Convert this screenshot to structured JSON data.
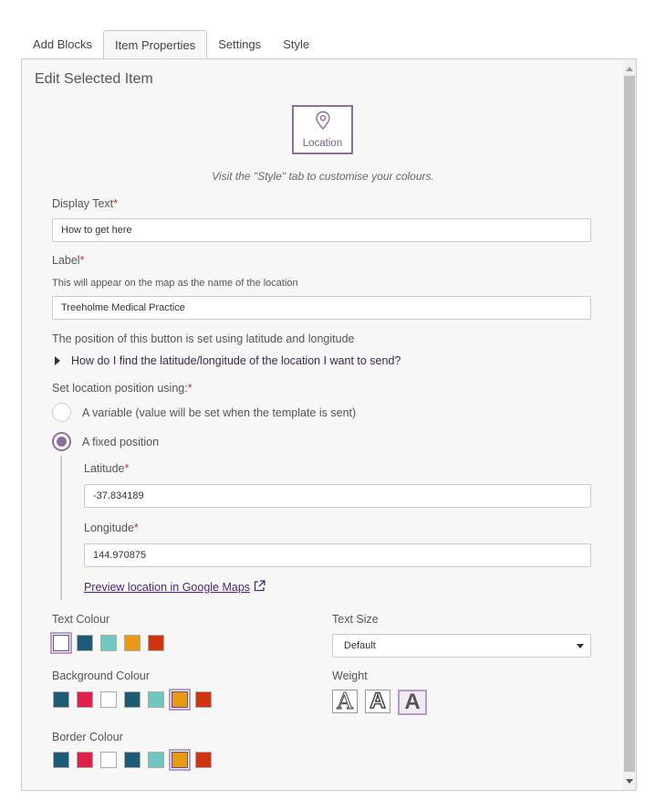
{
  "tabs": [
    {
      "label": "Add Blocks"
    },
    {
      "label": "Item Properties",
      "active": true
    },
    {
      "label": "Settings"
    },
    {
      "label": "Style"
    }
  ],
  "panel": {
    "heading": "Edit Selected Item",
    "tile": {
      "icon": "map-pin-icon",
      "label": "Location"
    },
    "hint": "Visit the \"Style\" tab to customise your colours.",
    "display_text": {
      "label": "Display Text",
      "required_mark": "*",
      "value": "How to get here"
    },
    "label_field": {
      "label": "Label",
      "required_mark": "*",
      "help": "This will appear on the map as the name of the location",
      "value": "Treeholme Medical Practice"
    },
    "position_note": "The position of this button is set using latitude and longitude",
    "disclosure": "How do I find the latitude/longitude of the location I want to send?",
    "set_position": {
      "label": "Set location position using:",
      "required_mark": "*",
      "options": [
        {
          "label": "A variable (value will be set when the template is sent)",
          "checked": false
        },
        {
          "label": "A fixed position",
          "checked": true
        }
      ]
    },
    "latitude": {
      "label": "Latitude",
      "required_mark": "*",
      "value": "-37.834189"
    },
    "longitude": {
      "label": "Longitude",
      "required_mark": "*",
      "value": "144.970875"
    },
    "preview_link": "Preview location in Google Maps",
    "text_colour": {
      "label": "Text Colour",
      "swatches": [
        "#ffffff",
        "#1d5a73",
        "#6fc8c0",
        "#e89a16",
        "#d0340f"
      ],
      "selected_index": 0
    },
    "background_colour": {
      "label": "Background Colour",
      "swatches": [
        "#1d5a73",
        "#e01f4c",
        "#ffffff",
        "#1d5a73",
        "#6fc8c0",
        "#e89a16",
        "#d0340f"
      ],
      "selected_index": 5
    },
    "border_colour": {
      "label": "Border Colour",
      "swatches": [
        "#1d5a73",
        "#e01f4c",
        "#ffffff",
        "#1d5a73",
        "#6fc8c0",
        "#e89a16",
        "#d0340f"
      ],
      "selected_index": 5
    },
    "text_size": {
      "label": "Text Size",
      "value": "Default"
    },
    "weight": {
      "label": "Weight",
      "options": [
        {
          "glyph": "A",
          "name": "light"
        },
        {
          "glyph": "A",
          "name": "medium"
        },
        {
          "glyph": "A",
          "name": "bold"
        }
      ],
      "selected_index": 2
    }
  },
  "colors": {
    "accent": "#8c6d9e",
    "required": "#c0392b",
    "link": "#4a2a6a"
  }
}
